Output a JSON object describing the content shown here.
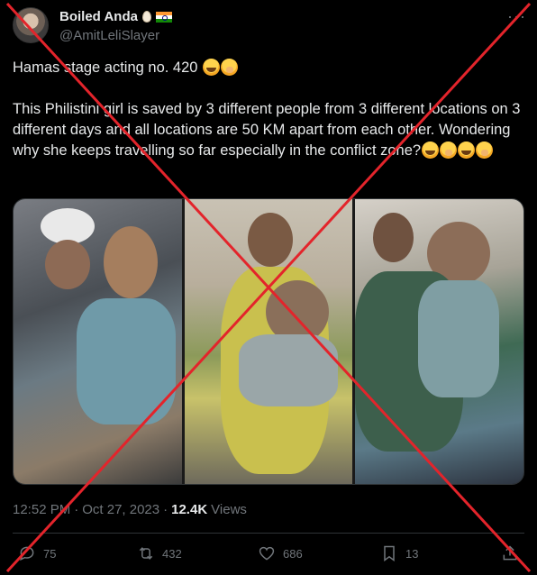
{
  "author": {
    "display_name": "Boiled Anda",
    "handle": "@AmitLeliSlayer",
    "badges": [
      "egg-emoji",
      "india-flag"
    ]
  },
  "menu_icon": "more-dots-icon",
  "text": {
    "line1": "Hamas stage acting no. 420",
    "line2": "This Philistini girl is saved by 3 different people from 3 different locations on 3 different days and all locations are 50 KM apart from each other. Wondering why she keeps travelling so far especially in the conflict zone?",
    "line1_emojis": [
      "laughing-emoji",
      "hand-over-mouth-emoji"
    ],
    "line2_emojis": [
      "laughing-emoji",
      "hand-over-mouth-emoji",
      "laughing-emoji",
      "hand-over-mouth-emoji"
    ]
  },
  "media": {
    "panels": [
      "photo-1",
      "photo-2",
      "photo-3"
    ]
  },
  "meta": {
    "time": "12:52 PM",
    "separator": "·",
    "date": "Oct 27, 2023",
    "views_count": "12.4K",
    "views_label": "Views"
  },
  "actions": {
    "replies": "75",
    "reposts": "432",
    "likes": "686",
    "bookmarks": "13"
  },
  "overlay": {
    "mark": "red-x-cross",
    "color": "#e3242b"
  },
  "colors": {
    "background": "#000000",
    "text": "#e7e9ea",
    "muted": "#71767b"
  }
}
